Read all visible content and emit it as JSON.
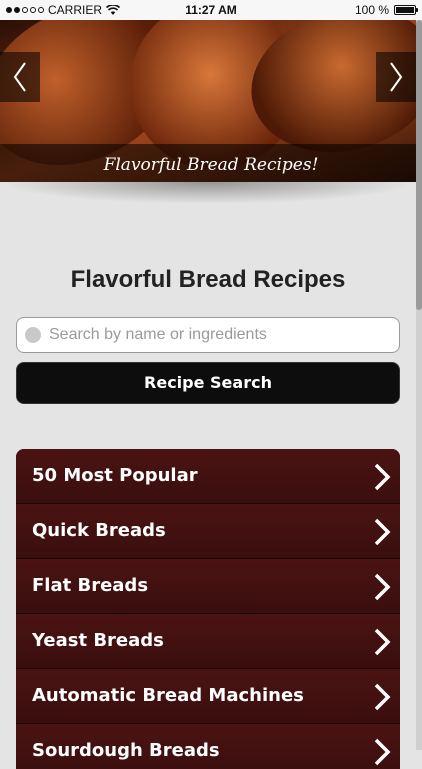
{
  "status_bar": {
    "carrier": "CARRIER",
    "time": "11:27 AM",
    "battery": "100 %",
    "battery_level": 1.0
  },
  "banner": {
    "caption": "Flavorful Bread Recipes!"
  },
  "page": {
    "title": "Flavorful Bread Recipes"
  },
  "search": {
    "placeholder": "Search by name or ingredients",
    "button_label": "Recipe Search"
  },
  "menu": {
    "items": [
      {
        "label": "50 Most Popular"
      },
      {
        "label": "Quick Breads"
      },
      {
        "label": "Flat Breads"
      },
      {
        "label": "Yeast Breads"
      },
      {
        "label": "Automatic Bread Machines"
      },
      {
        "label": "Sourdough Breads"
      }
    ]
  },
  "colors": {
    "menu_bg": "#3a0e0e",
    "button_bg": "#0d0d0d",
    "page_bg": "#e4e4e4"
  }
}
